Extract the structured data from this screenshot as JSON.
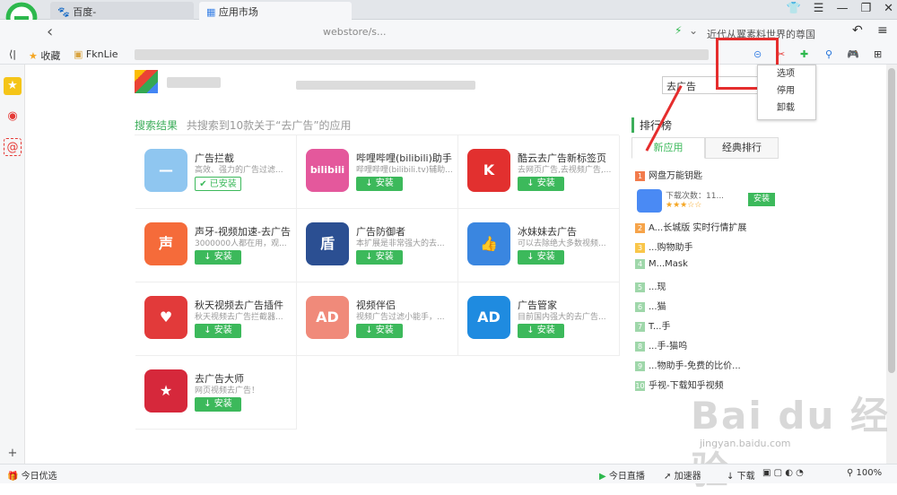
{
  "browser": {
    "tabs": [
      {
        "label": "百度-"
      },
      {
        "label": "应用市场"
      }
    ],
    "url": "webstore/s...",
    "search_placeholder": "近代从翼素料世界的尊国",
    "bookmarks": [
      {
        "label": "收藏"
      },
      {
        "label": "FknLie"
      }
    ]
  },
  "page": {
    "search_value": "去广告",
    "results_title": "搜索结果",
    "results_subtitle": "共搜索到10款关于“去广告”的应用",
    "apps": [
      {
        "name": "广告拦截",
        "desc": "高效、强力的广告过滤...",
        "button": "已安装",
        "installed": true,
        "icon_text": "—",
        "color": "#8fc6f0"
      },
      {
        "name": "哔哩哔哩(bilibili)助手",
        "desc": "哔哩哔哩(bilibili.tv)辅助...",
        "button": "安装",
        "installed": false,
        "icon_text": "bilibili",
        "color": "#e4589c"
      },
      {
        "name": "酷云去广告新标签页",
        "desc": "去网页广告,去视频广告,...",
        "button": "安装",
        "installed": false,
        "icon_text": "K",
        "color": "#e2302f"
      },
      {
        "name": "声牙-视频加速-去广告",
        "desc": "3000000人都在用，观...",
        "button": "安装",
        "installed": false,
        "icon_text": "声",
        "color": "#f56b3a"
      },
      {
        "name": "广告防御者",
        "desc": "本扩展是非常强大的去...",
        "button": "安装",
        "installed": false,
        "icon_text": "盾",
        "color": "#2b4f92"
      },
      {
        "name": "冰妹妹去广告",
        "desc": "可以去除绝大多数视频...",
        "button": "安装",
        "installed": false,
        "icon_text": "👍",
        "color": "#3a86e0"
      },
      {
        "name": "秋天视频去广告插件",
        "desc": "秋天视频去广告拦截器...",
        "button": "安装",
        "installed": false,
        "icon_text": "♥",
        "color": "#e23a3a"
      },
      {
        "name": "视频伴侣",
        "desc": "视频广告过滤小能手，...",
        "button": "安装",
        "installed": false,
        "icon_text": "AD",
        "color": "#f08a7a"
      },
      {
        "name": "广告管家",
        "desc": "目前国内强大的去广告...",
        "button": "安装",
        "installed": false,
        "icon_text": "AD",
        "color": "#1f8be0"
      },
      {
        "name": "去广告大师",
        "desc": "网页视频去广告！",
        "button": "安装",
        "installed": false,
        "icon_text": "★",
        "color": "#d6283b"
      }
    ],
    "ranking": {
      "title": "排行榜",
      "tabs": [
        "新应用",
        "经典排行"
      ],
      "top_item": {
        "name": "网盘万能钥匙",
        "downloads": "下载次数：11...",
        "button": "安装"
      },
      "items": [
        {
          "n": "2",
          "label": "A...长城版 实时行情扩展"
        },
        {
          "n": "3",
          "label": "...购物助手"
        },
        {
          "n": "4",
          "label": "M...Mask"
        },
        {
          "n": "5",
          "label": "...现"
        },
        {
          "n": "6",
          "label": "...猫"
        },
        {
          "n": "7",
          "label": "T...手"
        },
        {
          "n": "8",
          "label": "...手-猫呜"
        },
        {
          "n": "9",
          "label": "...物助手-免费的比价..."
        },
        {
          "n": "10",
          "label": "乎视-下载知乎视频"
        }
      ]
    }
  },
  "popup_menu": {
    "items": [
      "选项",
      "停用",
      "卸载"
    ]
  },
  "statusbar": {
    "left": "今日优选",
    "items": [
      "今日直播",
      "加速器",
      "下载",
      "100%"
    ]
  },
  "watermark": {
    "main": "Bai du 经验",
    "sub": "jingyan.baidu.com"
  },
  "colors": {
    "accent": "#3cb95b",
    "highlight": "#e52d2d"
  }
}
